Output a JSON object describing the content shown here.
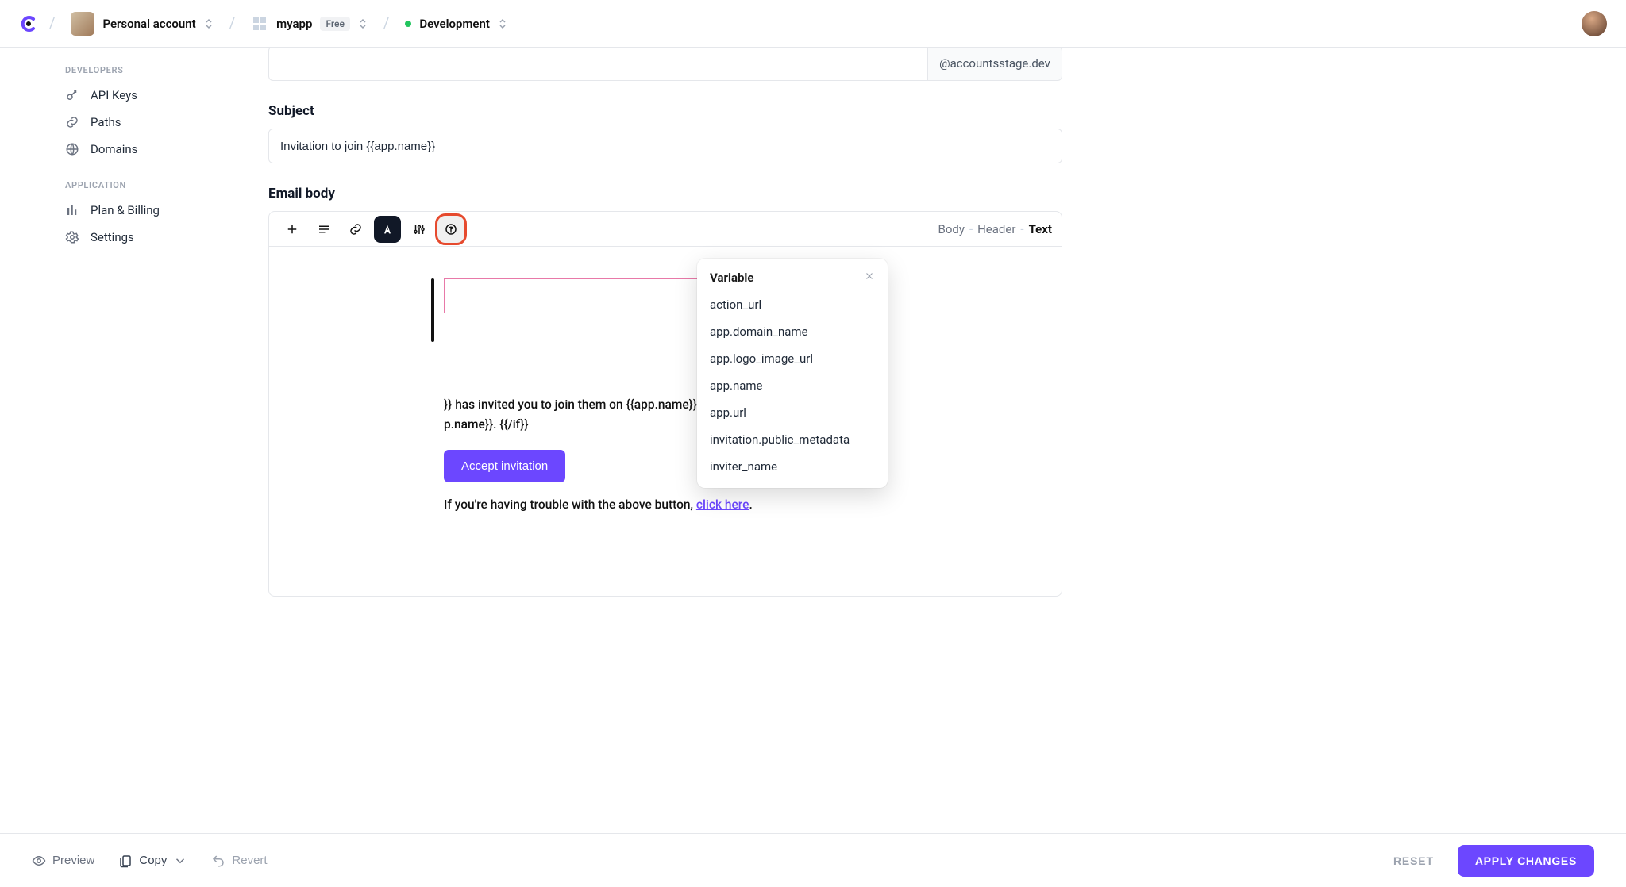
{
  "topbar": {
    "account_label": "Personal account",
    "app_name": "myapp",
    "plan_badge": "Free",
    "env_name": "Development"
  },
  "sidebar": {
    "developers_section": "DEVELOPERS",
    "application_section": "APPLICATION",
    "items": {
      "api_keys": "API Keys",
      "paths": "Paths",
      "domains": "Domains",
      "plan_billing": "Plan & Billing",
      "settings": "Settings"
    }
  },
  "form": {
    "from_suffix": "@accountsstage.dev",
    "subject_label": "Subject",
    "subject_value": "Invitation to join {{app.name}}",
    "body_label": "Email body"
  },
  "toolbar_path": {
    "body": "Body",
    "header": "Header",
    "text": "Text"
  },
  "email": {
    "body_line1": "}} has invited you to join them on {{app.name}}.",
    "body_line2": "p.name}}. {{/if}}",
    "accept_button": "Accept invitation",
    "trouble_prefix": "If you're having trouble with the above button, ",
    "trouble_link": "click here",
    "trouble_suffix": "."
  },
  "popover": {
    "title": "Variable",
    "items": [
      "action_url",
      "app.domain_name",
      "app.logo_image_url",
      "app.name",
      "app.url",
      "invitation.public_metadata",
      "inviter_name"
    ]
  },
  "footer": {
    "preview": "Preview",
    "copy": "Copy",
    "revert": "Revert",
    "reset": "RESET",
    "apply": "APPLY CHANGES"
  }
}
